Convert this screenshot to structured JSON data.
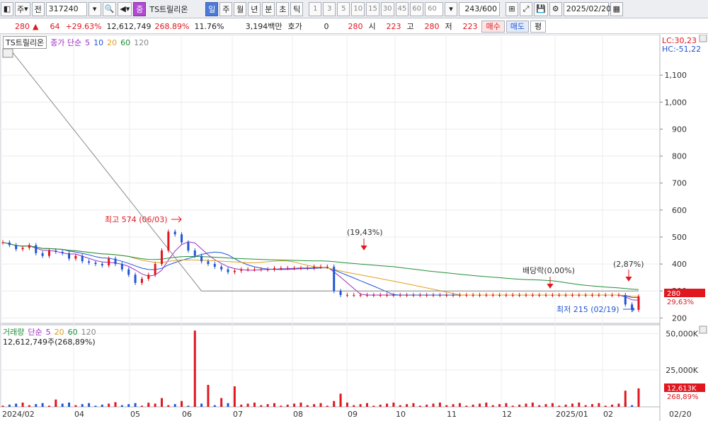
{
  "toolbar": {
    "period_label": "주",
    "prev_label": "전",
    "code": "317240",
    "stock_badge": "중",
    "stock_name": "TS트릴리온",
    "tf_day": "일",
    "tf_week": "주",
    "tf_month": "월",
    "tf_year": "년",
    "tf_min": "분",
    "tf_sec": "초",
    "tf_tick": "틱",
    "periods": [
      "1",
      "3",
      "5",
      "10",
      "15",
      "30",
      "45",
      "60"
    ],
    "period_custom": "60",
    "count": "243/600",
    "date": "2025/02/20"
  },
  "quote": {
    "price": "280",
    "change": "64",
    "change_pct": "+29.63%",
    "volume": "12,612,749",
    "vol_ratio": "268.89%",
    "turnover": "11.76%",
    "amount": "3,194백만",
    "hoga_label": "호가",
    "hoga_value": "0",
    "hoga_price": "280",
    "open_label": "시",
    "open": "223",
    "high_label": "고",
    "high": "280",
    "low_label": "저",
    "low": "223",
    "buy": "매수",
    "sell": "매도",
    "eval": "평"
  },
  "price_panel": {
    "stock_name": "TS트릴리온",
    "ma_label": "종가 단순",
    "ma_periods": [
      "5",
      "10",
      "20",
      "60",
      "120"
    ],
    "lc": "LC:30,23",
    "hc": "HC:-51,22",
    "y_ticks": [
      "1,100",
      "1,000",
      "900",
      "800",
      "700",
      "600",
      "500",
      "400",
      "300",
      "200"
    ],
    "current_price_tag": "280",
    "current_pct_tag": "29,63%",
    "annotations": {
      "high": "최고 574 (06/03)",
      "pct1": "(19,43%)",
      "dividend": "배당락(0,00%)",
      "pct2": "(2,87%)",
      "low": "최저 215 (02/19)"
    }
  },
  "volume_panel": {
    "label": "거래량",
    "ma_label": "단순",
    "ma_periods": [
      "5",
      "20",
      "60",
      "120"
    ],
    "current": "12,612,749주(268,89%)",
    "y_ticks": [
      "50,000K",
      "25,000K"
    ],
    "tag_volume": "12,613K",
    "tag_pct": "268,89%"
  },
  "x_axis": [
    "2024/02",
    "04",
    "05",
    "06",
    "07",
    "08",
    "09",
    "10",
    "11",
    "12",
    "2025/01",
    "02",
    "02/20"
  ],
  "colors": {
    "up": "#e0171f",
    "down": "#1f55d6",
    "ma5": "#9b2fc4",
    "ma10": "#1f55d6",
    "ma20": "#e0a020",
    "ma60": "#1f8f3a",
    "ma120": "#888888"
  },
  "chart_data": {
    "type": "candlestick",
    "price_range": [
      180,
      1250
    ],
    "ma120_start": 1230,
    "closes": [
      480,
      470,
      455,
      460,
      470,
      440,
      430,
      450,
      445,
      440,
      420,
      430,
      410,
      405,
      400,
      395,
      420,
      400,
      380,
      360,
      330,
      345,
      360,
      400,
      450,
      520,
      510,
      480,
      450,
      430,
      410,
      400,
      390,
      380,
      370,
      375,
      380,
      380,
      380,
      380,
      380,
      385,
      385,
      385,
      385,
      385,
      385,
      390,
      390,
      390,
      300,
      285,
      285,
      285,
      285,
      285,
      285,
      285,
      285,
      285,
      285,
      285,
      285,
      285,
      285,
      285,
      285,
      285,
      285,
      285,
      285,
      285,
      285,
      285,
      285,
      285,
      285,
      285,
      285,
      285,
      285,
      285,
      285,
      285,
      285,
      285,
      285,
      285,
      285,
      285,
      285,
      285,
      285,
      285,
      250,
      230,
      280
    ],
    "volume_spikes_K": [
      5000,
      3200,
      2800,
      6000,
      4000,
      52000,
      15000,
      6000,
      14000,
      4000,
      9000,
      11000,
      12613
    ]
  }
}
